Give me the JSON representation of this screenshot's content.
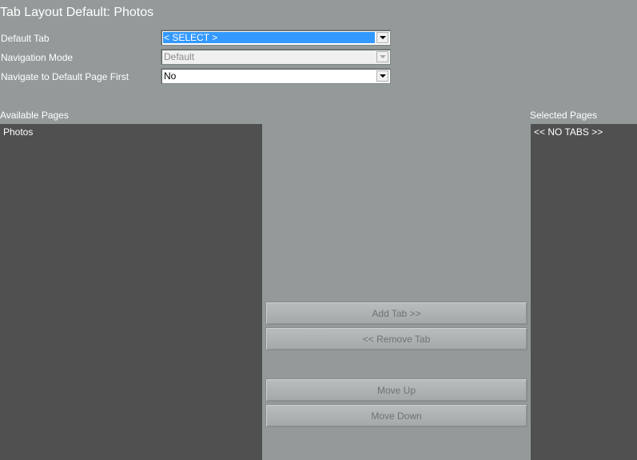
{
  "page": {
    "title": "Tab Layout Default: Photos"
  },
  "form": {
    "default_tab": {
      "label": "Default Tab",
      "value": "< SELECT >"
    },
    "navigation_mode": {
      "label": "Navigation Mode",
      "value": "Default"
    },
    "navigate_first": {
      "label": "Navigate to Default Page First",
      "value": "No"
    }
  },
  "available": {
    "label": "Available Pages",
    "items": [
      "Photos"
    ]
  },
  "selected": {
    "label": "Selected Pages",
    "items": [
      "<< NO TABS >>"
    ]
  },
  "buttons": {
    "add_tab": "Add Tab >>",
    "remove_tab": "<< Remove Tab",
    "move_up": "Move Up",
    "move_down": "Move Down"
  }
}
